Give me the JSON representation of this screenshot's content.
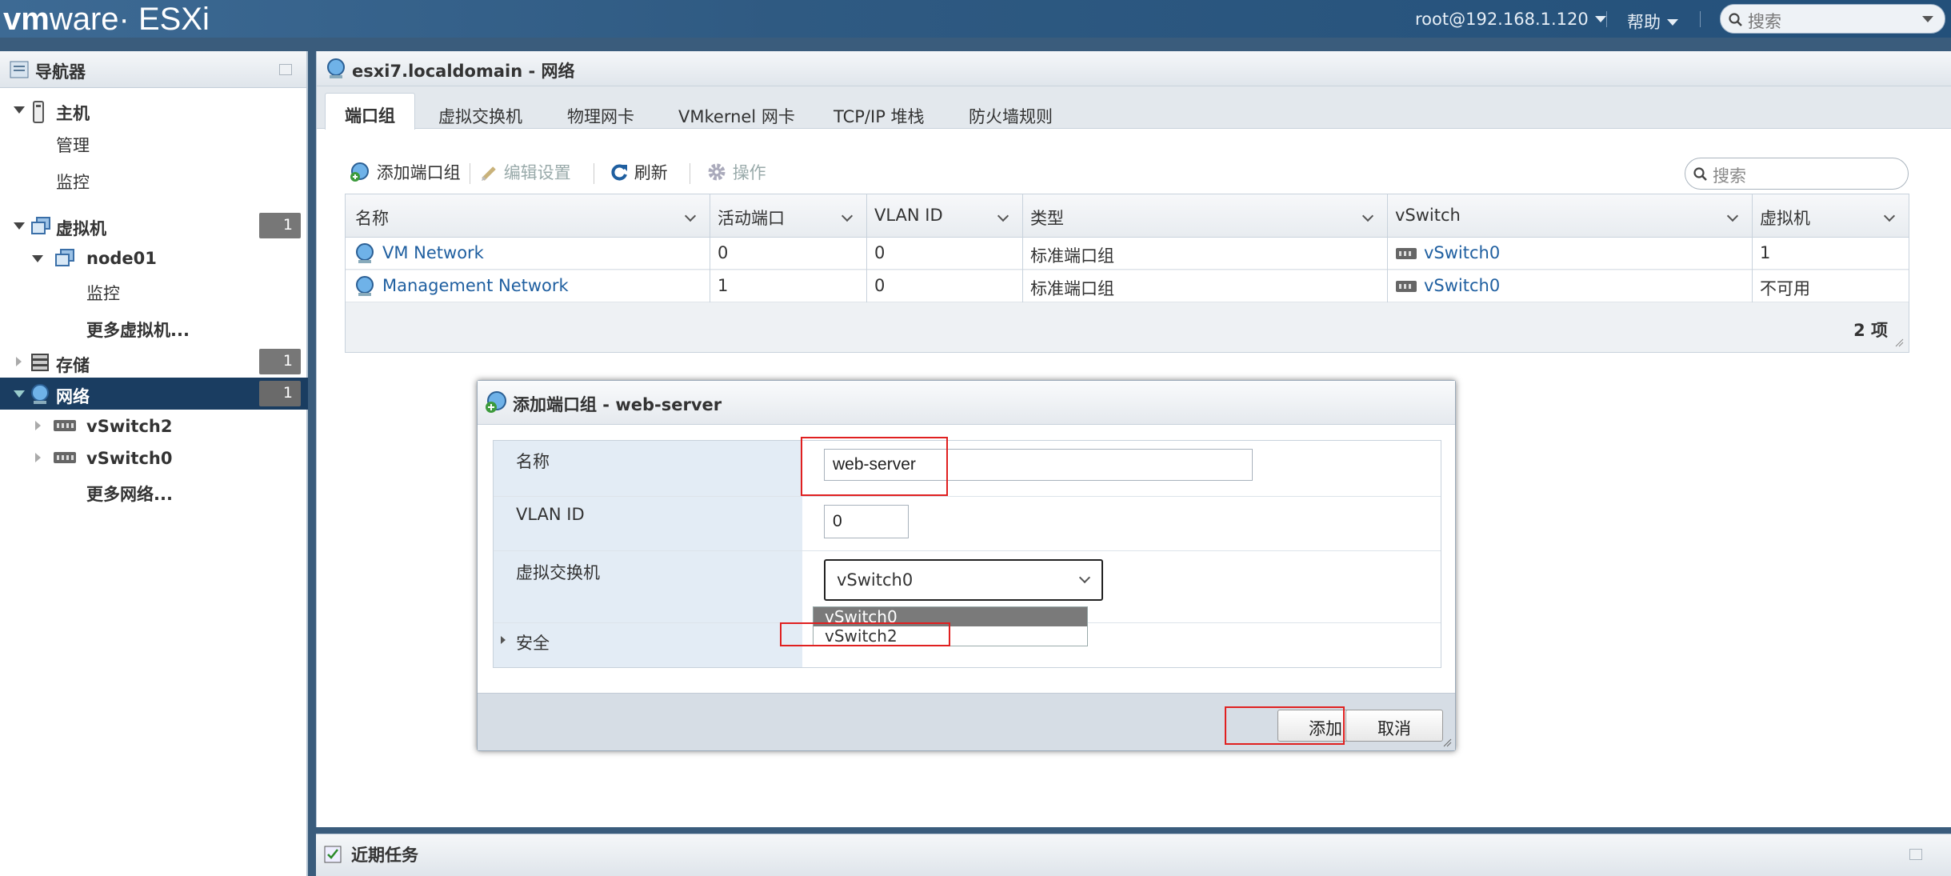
{
  "topbar": {
    "brand_vm": "vm",
    "brand_rest": "ware· ESXi",
    "user": "root@192.168.1.120",
    "help": "帮助",
    "search_placeholder": "搜索"
  },
  "navigator": {
    "title": "导航器",
    "items": [
      {
        "label": "主机"
      },
      {
        "label": "管理"
      },
      {
        "label": "监控"
      },
      {
        "label": "虚拟机",
        "count": "1"
      },
      {
        "label": "node01"
      },
      {
        "label": "监控"
      },
      {
        "label": "更多虚拟机..."
      },
      {
        "label": "存储",
        "count": "1"
      },
      {
        "label": "网络",
        "count": "1"
      },
      {
        "label": "vSwitch2"
      },
      {
        "label": "vSwitch0"
      },
      {
        "label": "更多网络..."
      }
    ]
  },
  "main": {
    "title": "esxi7.localdomain - 网络",
    "tabs": [
      "端口组",
      "虚拟交换机",
      "物理网卡",
      "VMkernel 网卡",
      "TCP/IP 堆栈",
      "防火墙规则"
    ],
    "toolbar": {
      "add": "添加端口组",
      "edit": "编辑设置",
      "refresh": "刷新",
      "actions": "操作",
      "search_placeholder": "搜索"
    },
    "grid": {
      "columns": [
        "名称",
        "活动端口",
        "VLAN ID",
        "类型",
        "vSwitch",
        "虚拟机"
      ],
      "rows": [
        [
          "VM Network",
          "0",
          "0",
          "标准端口组",
          "vSwitch0",
          "1"
        ],
        [
          "Management Network",
          "1",
          "0",
          "标准端口组",
          "vSwitch0",
          "不可用"
        ]
      ],
      "footer": "2 项"
    }
  },
  "dialog": {
    "title": "添加端口组 - web-server",
    "name_label": "名称",
    "name_value": "web-server",
    "vlan_label": "VLAN ID",
    "vlan_value": "0",
    "vswitch_label": "虚拟交换机",
    "vswitch_value": "vSwitch0",
    "vswitch_options": [
      "vSwitch0",
      "vSwitch2"
    ],
    "security_label": "安全",
    "add_button": "添加",
    "cancel_button": "取消"
  },
  "recent_tasks": {
    "title": "近期任务"
  },
  "colors": {
    "accent": "#1a3d61",
    "link": "#1f5fa0",
    "highlight": "#e02020"
  }
}
